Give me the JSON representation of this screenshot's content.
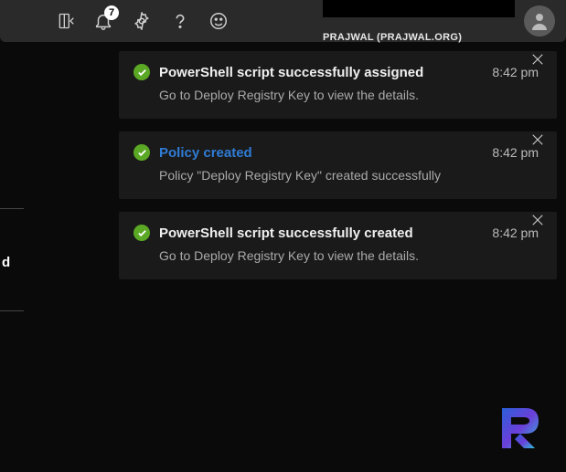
{
  "topbar": {
    "notification_count": "7",
    "username": "PRAJWAL (PRAJWAL.ORG)"
  },
  "sidebar_fragment": {
    "char": "d"
  },
  "notifications": [
    {
      "title": "PowerShell script successfully assigned",
      "time": "8:42 pm",
      "body": "Go to Deploy Registry Key to view the details.",
      "is_link": false
    },
    {
      "title": "Policy created",
      "time": "8:42 pm",
      "body": "Policy \"Deploy Registry Key\" created successfully",
      "is_link": true
    },
    {
      "title": "PowerShell script successfully created",
      "time": "8:42 pm",
      "body": "Go to Deploy Registry Key to view the details.",
      "is_link": false
    }
  ]
}
